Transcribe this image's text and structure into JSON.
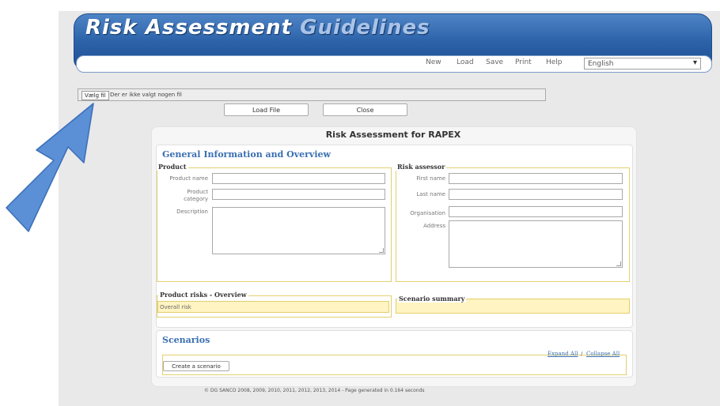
{
  "app": {
    "title_main": "Risk Assessment ",
    "title_tail": "Guidelines"
  },
  "menu": {
    "new": "New",
    "load": "Load",
    "save": "Save",
    "print": "Print",
    "help": "Help",
    "language": "English"
  },
  "file": {
    "choose_button": "Vælg fil",
    "status_text": "Der er ikke valgt nogen fil",
    "load_button": "Load File",
    "close_button": "Close"
  },
  "form": {
    "title": "Risk Assessment for RAPEX",
    "general_section": "General Information and Overview",
    "product": {
      "legend": "Product",
      "name_label": "Product name",
      "category_label_1": "Product",
      "category_label_2": "category",
      "description_label": "Description"
    },
    "assessor": {
      "legend": "Risk assessor",
      "first_name_label": "First name",
      "last_name_label": "Last name",
      "organisation_label": "Organisation",
      "address_label": "Address"
    },
    "product_risks": {
      "legend": "Product risks - Overview",
      "overall": "Overall risk"
    },
    "scenario_summary": "Scenario summary",
    "scenarios": {
      "title": "Scenarios",
      "expand_all": "Expand All",
      "separator": "/",
      "collapse_all": "Collapse All",
      "create_button": "Create a scenario"
    }
  },
  "footer": "© DG SANCO 2008, 2009, 2010, 2011, 2012, 2013, 2014 - Page generated in 0.164 seconds",
  "colors": {
    "header_blue": "#2c62a8",
    "section_blue": "#3a6fb0",
    "highlight_yellow": "#fff4c2",
    "arrow_blue": "#5b8fd6"
  }
}
